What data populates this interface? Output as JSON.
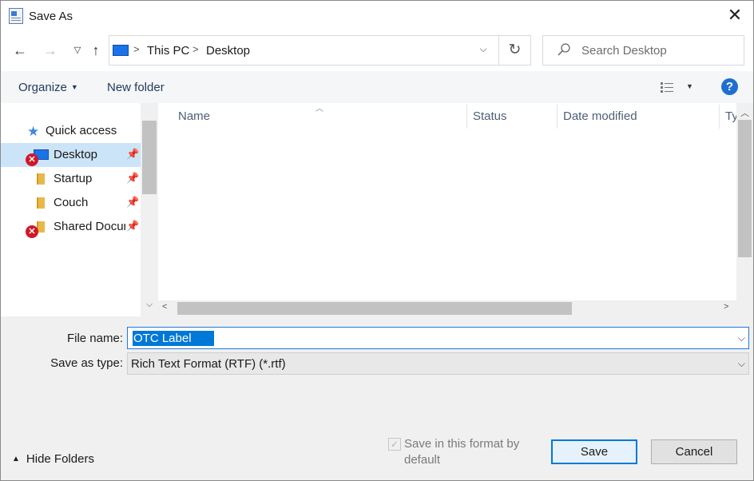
{
  "window": {
    "title": "Save As"
  },
  "nav": {
    "breadcrumb": [
      "This PC",
      "Desktop"
    ],
    "search_placeholder": "Search Desktop"
  },
  "commands": {
    "organize": "Organize",
    "new_folder": "New folder",
    "help": "?"
  },
  "navpane": {
    "items": [
      {
        "label": "Quick access",
        "icon": "star-icon",
        "pinned": false,
        "error": false
      },
      {
        "label": "Desktop",
        "icon": "desktop-icon",
        "pinned": true,
        "error": true,
        "selected": true
      },
      {
        "label": "Startup",
        "icon": "folder-icon",
        "pinned": true,
        "error": false
      },
      {
        "label": "Couch",
        "icon": "folder-icon",
        "pinned": true,
        "error": false
      },
      {
        "label": "Shared Docur",
        "icon": "folder-icon",
        "pinned": true,
        "error": true
      }
    ]
  },
  "filelist": {
    "columns": [
      "Name",
      "Status",
      "Date modified",
      "Ty"
    ]
  },
  "form": {
    "filename_label": "File name:",
    "filename_value": "OTC Label",
    "type_label": "Save as type:",
    "type_value": "Rich Text Format (RTF) (*.rtf)"
  },
  "footer": {
    "hide_folders": "Hide Folders",
    "save_format_default": "Save in this format by default",
    "save_format_checked": true,
    "save": "Save",
    "cancel": "Cancel"
  },
  "colors": {
    "accent": "#0078d7",
    "selection": "#cce4f7",
    "error": "#d0182a"
  }
}
